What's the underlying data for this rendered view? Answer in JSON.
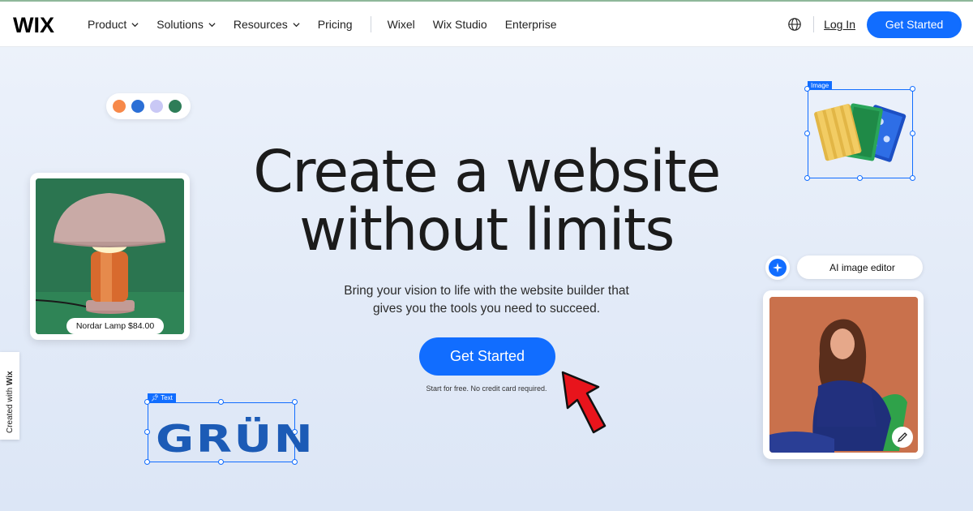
{
  "nav": {
    "logo": "WIX",
    "items": [
      {
        "label": "Product",
        "dropdown": true
      },
      {
        "label": "Solutions",
        "dropdown": true
      },
      {
        "label": "Resources",
        "dropdown": true
      },
      {
        "label": "Pricing",
        "dropdown": false
      }
    ],
    "secondary": [
      "Wixel",
      "Wix Studio",
      "Enterprise"
    ],
    "login": "Log In",
    "get_started": "Get Started"
  },
  "hero": {
    "title_line1": "Create a website",
    "title_line2": "without limits",
    "subtitle_line1": "Bring your vision to life with the website builder that",
    "subtitle_line2": "gives you the tools you need to succeed.",
    "cta": "Get Started",
    "cta_note": "Start for free. No credit card required."
  },
  "palette": {
    "colors": [
      "#f7894a",
      "#2b6fd6",
      "#c9c8f5",
      "#2e7d58"
    ]
  },
  "lamp_card": {
    "price": "Nordar Lamp $84.00"
  },
  "created_with": {
    "text": "Created with ",
    "brand": "Wix"
  },
  "text_element": {
    "tag": "Text",
    "word": "GRÜN"
  },
  "image_element": {
    "tag": "Image"
  },
  "ai_editor": {
    "label": "AI image editor"
  },
  "colors": {
    "accent": "#116dff",
    "arrow": "#e8141c"
  }
}
